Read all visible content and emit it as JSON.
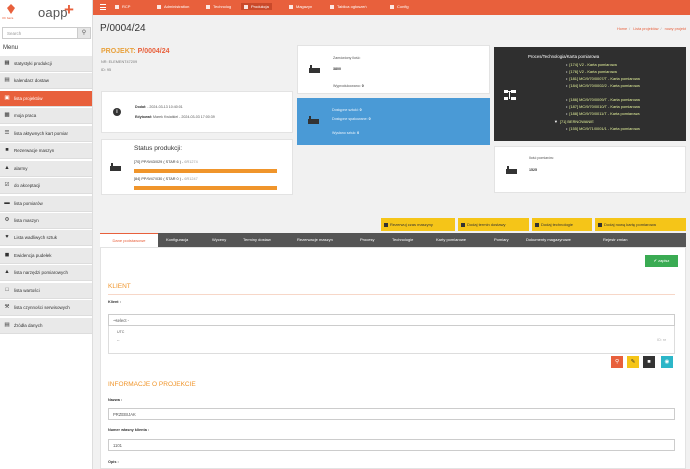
{
  "app": {
    "logo": "oapp",
    "logo_small": "Oh baza"
  },
  "sidebar": {
    "search_placeholder": "Search",
    "menu_title": "Menu",
    "items": [
      {
        "label": "statystyki produkcji",
        "icon": "chart-icon"
      },
      {
        "label": "kalendarz dostaw",
        "icon": "calendar-icon"
      },
      {
        "label": "lista projektów",
        "icon": "folder-icon",
        "active": true
      },
      {
        "label": "moja praca",
        "icon": "briefcase-icon"
      },
      {
        "label": "lista aktywnych kart pomiar",
        "icon": "list-icon"
      },
      {
        "label": "Rezerwacje maszyn",
        "icon": "machine-icon"
      },
      {
        "label": "alarmy",
        "icon": "bell-icon"
      },
      {
        "label": "do akceptacji",
        "icon": "check-icon"
      },
      {
        "label": "lista pomiarów",
        "icon": "ruler-icon"
      },
      {
        "label": "lista maszyn",
        "icon": "gear-icon"
      },
      {
        "label": "Lista wadliwych sztuk",
        "icon": "heart-icon"
      },
      {
        "label": "Ewidencja pudełek",
        "icon": "box-icon"
      },
      {
        "label": "lista narzędzi pomiarowych",
        "icon": "tool-icon"
      },
      {
        "label": "lista wartości",
        "icon": "values-icon"
      },
      {
        "label": "lista czynności serwisowych",
        "icon": "wrench-icon"
      },
      {
        "label": "Źródła danych",
        "icon": "database-icon"
      }
    ]
  },
  "topbar": {
    "items": [
      {
        "label": "RCP"
      },
      {
        "label": "Administration"
      },
      {
        "label": "Technolog"
      },
      {
        "label": "Produkcja",
        "active": true
      },
      {
        "label": "Magazyn"
      },
      {
        "label": "Tablica ogłoszeń"
      },
      {
        "label": "Config"
      }
    ]
  },
  "page": {
    "title": "P/0004/24",
    "breadcrumb": [
      "Home",
      "Lista projektów",
      "nowy projekt"
    ]
  },
  "project": {
    "label": "PROJEKT:",
    "number": "P/0004/24",
    "sub": "NR: ELEMENT47209",
    "id": "ID: 95",
    "added_label": "Dodał:",
    "added_value": "- 2024-03-13 10:40:01",
    "edited_label": "Edytował:",
    "edited_value": "Marek Kwiatkiel - 2024-03-03 17:00:39"
  },
  "status": {
    "title": "Status produkcji:",
    "rows": [
      {
        "text": "[70] PP/9/43/029 ( STAR 6 ) -",
        "sub": "6R1274",
        "progress": 0.95
      },
      {
        "text": "[84] PP/9/47/030 ( STAR 0 ) -",
        "sub": "6R1247",
        "progress": 0.95
      }
    ]
  },
  "stats": {
    "ordered_label": "Zamówiony ilość:",
    "ordered_value": "3800",
    "produced_label": "Wyprodukowano:",
    "produced_value": "0",
    "good_label": "Dostępne sztuki:",
    "good_value": "0",
    "packed_label": "Dostępne spakowane:",
    "packed_value": "0",
    "shipped_label": "Wysłano sztuk:",
    "shipped_value": "0",
    "meas_label": "Ilość pomiarów:",
    "meas_value": "1525"
  },
  "tree": {
    "title": "Proces/Technologia/Karta pomiarowa",
    "items": [
      {
        "text": "[174] V2 - Karta pomiarowa"
      },
      {
        "text": "[176] V2 - Karta pomiarowa"
      },
      {
        "text": "[181] MC/9/70/0007/T - Karta pomiarowa"
      },
      {
        "text": "[184] MC/9/70/0002/2 - Karta pomiarowa"
      },
      {
        "text": "[186] MC/9/70/0009/T - Karta pomiarowa"
      },
      {
        "text": "[187] MC/9/70/0010/T - Karta pomiarowa"
      },
      {
        "text": "[188] MC/9/70/0011/T - Karta pomiarowa"
      },
      {
        "text": "[71] BERNOWANIE"
      },
      {
        "text": "[155] MC/9/71/0001/1 - Karta pomiarowa"
      }
    ]
  },
  "actions": {
    "reserve": "Rezerwuj czas maszyny",
    "delivery": "Dodaj termin dostawy",
    "tech": "Dodaj technologie",
    "card": "Dodaj nową kartę pomiarowa"
  },
  "tabs": [
    "Dane podstawowe",
    "Konfiguracja",
    "Wyceny",
    "Terminy dostaw",
    "Rezerwacje maszyn",
    "Procesy",
    "Technologie",
    "Karty pomiarowe",
    "Pomiary",
    "Dokumenty magazynowe",
    "Rejestr zmian"
  ],
  "form": {
    "save": "zapisz",
    "client_section": "KLIENT",
    "client_label": "Klient :",
    "client_select": "- select -",
    "dd_line1": "UTC",
    "dd_line2": "--",
    "dd_id": "ID: nr",
    "info_section": "INFORMACJE O PROJEKCIE",
    "name_label": "Nazwa :",
    "name_value": "PRZEBIJAK",
    "client_no_label": "Numer własny klienta :",
    "client_no_value": "1101",
    "desc_label": "Opis :"
  },
  "colors": {
    "accent": "#e8603c",
    "blue": "#4a9ad6",
    "dark": "#2f2f2f",
    "yellow": "#f5c518",
    "green": "#3aab53",
    "orange": "#f0952b"
  }
}
